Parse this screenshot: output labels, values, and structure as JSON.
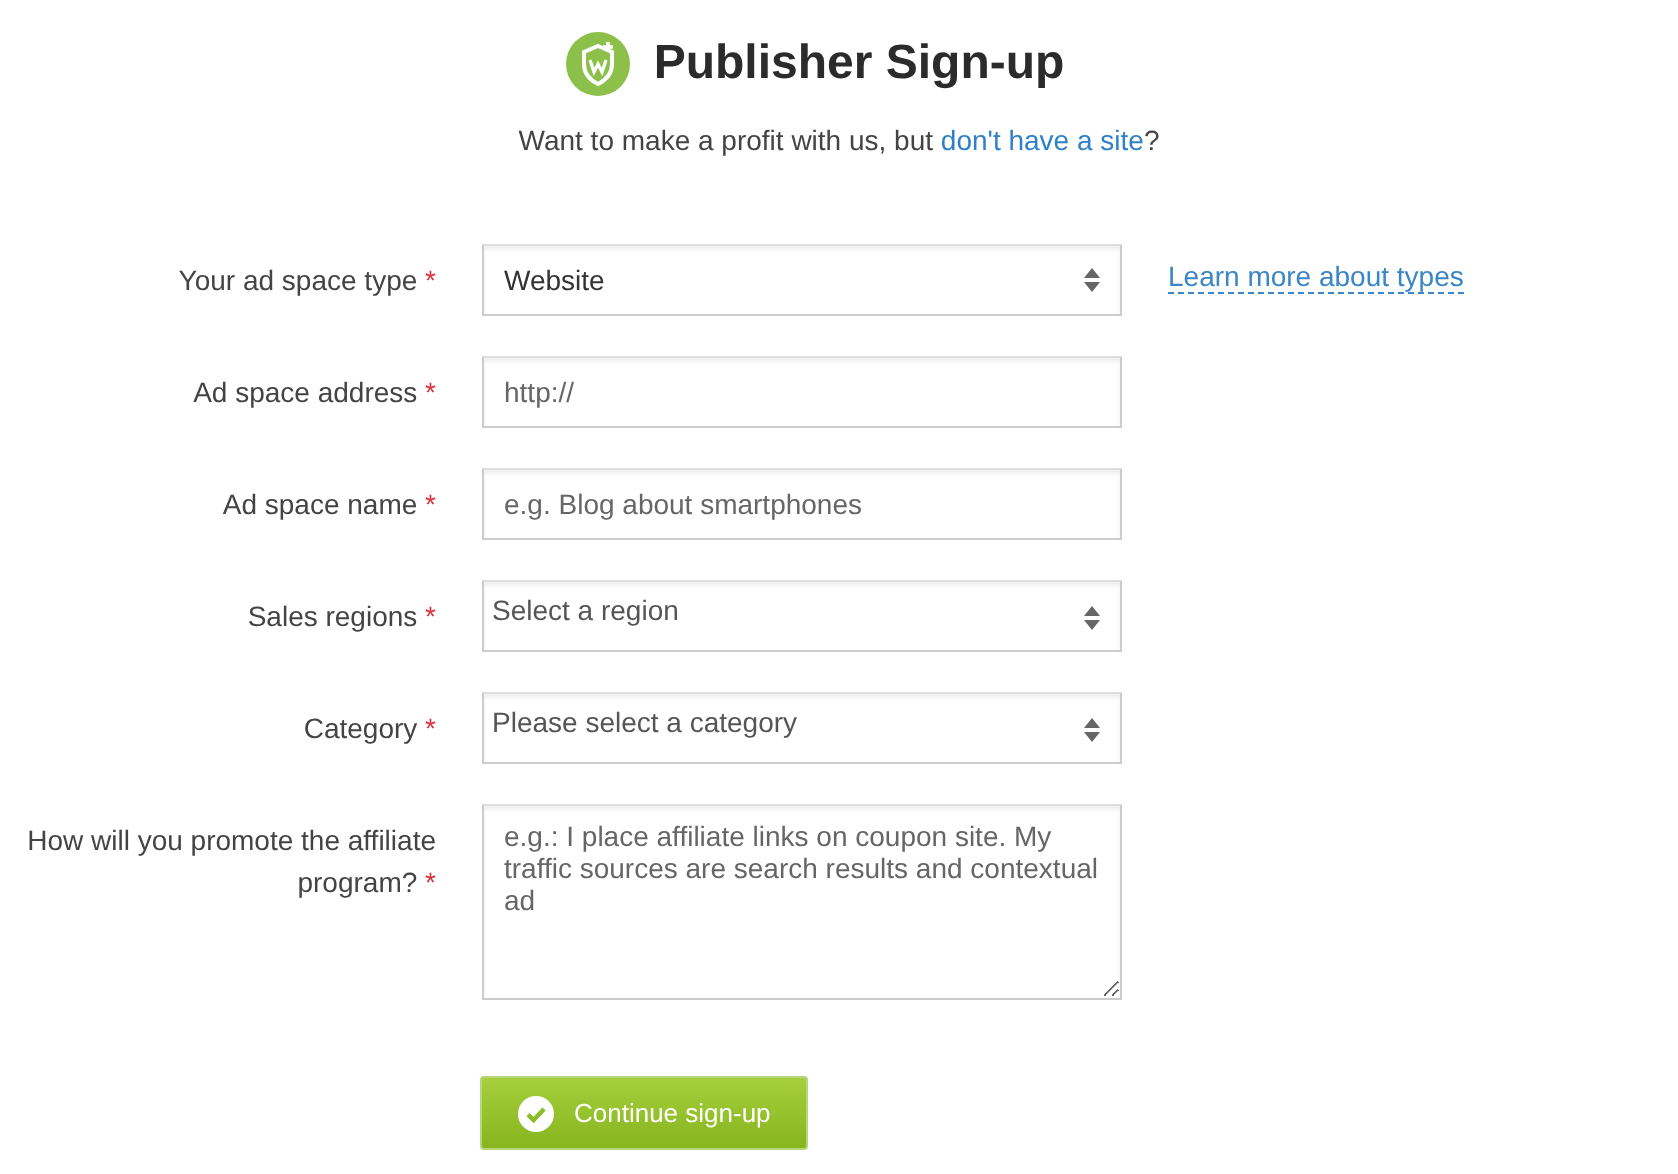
{
  "header": {
    "title": "Publisher Sign-up",
    "subtitle": {
      "before": "Want to make a profit with us, but ",
      "link": "don't have a site",
      "after": "?"
    }
  },
  "fields": [
    {
      "kind": "select",
      "label": "Your ad space type",
      "mark": "*",
      "value": "Website",
      "aside_link": "Learn more about types"
    },
    {
      "kind": "input",
      "label": "Ad space address",
      "mark": "*",
      "placeholder": "http://"
    },
    {
      "kind": "input",
      "label": "Ad space name",
      "mark": "*",
      "placeholder": "e.g. Blog about smartphones"
    },
    {
      "kind": "select",
      "label": "Sales regions",
      "mark": "*",
      "placeholder": "Select a region"
    },
    {
      "kind": "select",
      "label": "Category",
      "mark": "*",
      "placeholder": "Please select a category"
    },
    {
      "kind": "textarea",
      "label": "How will you promote the affiliate program?",
      "mark": "*",
      "placeholder": "e.g.: I place affiliate links on coupon site. My traffic sources are search results and contextual ad"
    }
  ],
  "submit": {
    "label": "Continue sign-up"
  }
}
